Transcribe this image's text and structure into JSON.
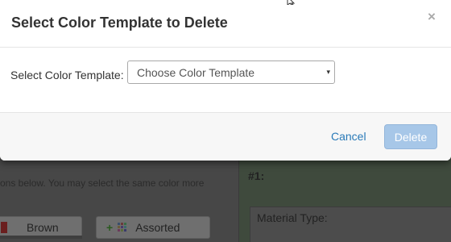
{
  "modal": {
    "title": "Select Color Template to Delete",
    "close_glyph": "×",
    "field_label": "Select Color Template:",
    "select": {
      "selected": "Choose Color Template",
      "arrow_glyph": "▾"
    },
    "cancel_label": "Cancel",
    "delete_label": "Delete",
    "delete_disabled": true
  },
  "background": {
    "instructions": "ons below. You may select the same color more",
    "swatches": [
      {
        "label": "Brown",
        "color": "#6a1f1f"
      },
      {
        "label": "Assorted",
        "plus_glyph": "+"
      }
    ],
    "section_heading": "#1:",
    "material_label": "Material Type:"
  },
  "colors": {
    "link": "#2a7ab8",
    "delete_disabled_bg": "#a7c7e8"
  },
  "icons": {
    "close": "close-icon",
    "dropdown": "chevron-down-icon",
    "cursor": "mouse-pointer-icon"
  }
}
